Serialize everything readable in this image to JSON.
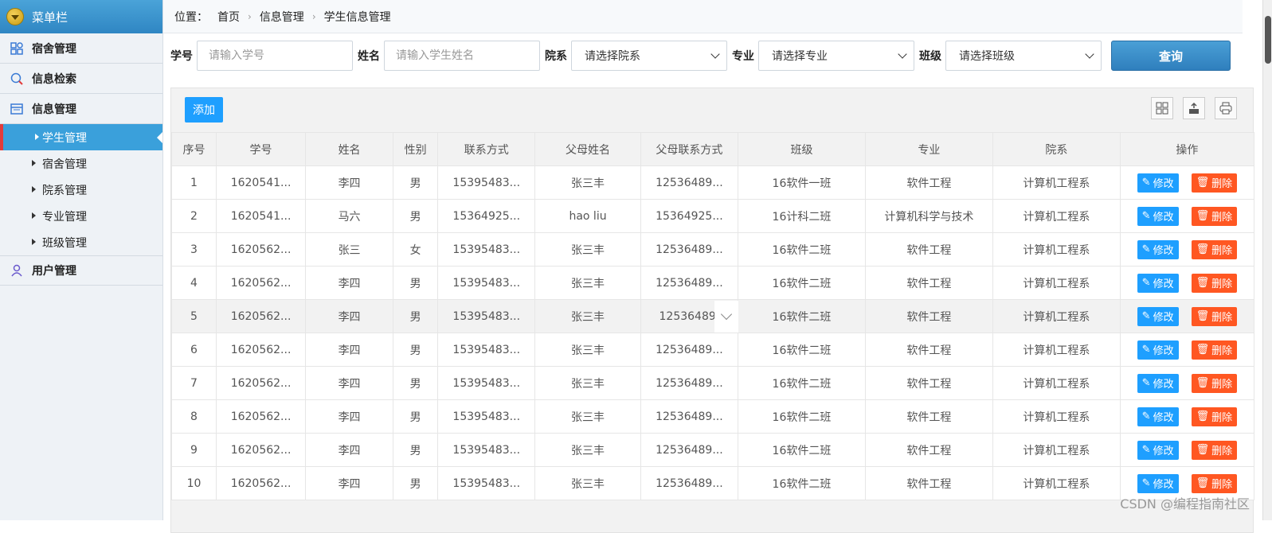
{
  "sidebar": {
    "title": "菜单栏",
    "groups": [
      {
        "label": "宿舍管理"
      },
      {
        "label": "信息检索"
      },
      {
        "label": "信息管理"
      },
      {
        "label": "用户管理"
      }
    ],
    "subitems": [
      "学生管理",
      "宿舍管理",
      "院系管理",
      "专业管理",
      "班级管理"
    ]
  },
  "breadcrumb": {
    "position_label": "位置：",
    "items": [
      "首页",
      "信息管理",
      "学生信息管理"
    ]
  },
  "search": {
    "id_label": "学号",
    "id_placeholder": "请输入学号",
    "name_label": "姓名",
    "name_placeholder": "请输入学生姓名",
    "dept_label": "院系",
    "dept_value": "请选择院系",
    "major_label": "专业",
    "major_value": "请选择专业",
    "class_label": "班级",
    "class_value": "请选择班级",
    "query_label": "查询"
  },
  "toolbar": {
    "add_label": "添加"
  },
  "table": {
    "headers": [
      "序号",
      "学号",
      "姓名",
      "性别",
      "联系方式",
      "父母姓名",
      "父母联系方式",
      "班级",
      "专业",
      "院系",
      "操作"
    ],
    "rows": [
      [
        "1",
        "1620541...",
        "李四",
        "男",
        "15395483...",
        "张三丰",
        "12536489...",
        "16软件一班",
        "软件工程",
        "计算机工程系"
      ],
      [
        "2",
        "1620541...",
        "马六",
        "男",
        "15364925...",
        "hao liu",
        "15364925...",
        "16计科二班",
        "计算机科学与技术",
        "计算机工程系"
      ],
      [
        "3",
        "1620562...",
        "张三",
        "女",
        "15395483...",
        "张三丰",
        "12536489...",
        "16软件二班",
        "软件工程",
        "计算机工程系"
      ],
      [
        "4",
        "1620562...",
        "李四",
        "男",
        "15395483...",
        "张三丰",
        "12536489...",
        "16软件二班",
        "软件工程",
        "计算机工程系"
      ],
      [
        "5",
        "1620562...",
        "李四",
        "男",
        "15395483...",
        "张三丰",
        "12536489.",
        "16软件二班",
        "软件工程",
        "计算机工程系"
      ],
      [
        "6",
        "1620562...",
        "李四",
        "男",
        "15395483...",
        "张三丰",
        "12536489...",
        "16软件二班",
        "软件工程",
        "计算机工程系"
      ],
      [
        "7",
        "1620562...",
        "李四",
        "男",
        "15395483...",
        "张三丰",
        "12536489...",
        "16软件二班",
        "软件工程",
        "计算机工程系"
      ],
      [
        "8",
        "1620562...",
        "李四",
        "男",
        "15395483...",
        "张三丰",
        "12536489...",
        "16软件二班",
        "软件工程",
        "计算机工程系"
      ],
      [
        "9",
        "1620562...",
        "李四",
        "男",
        "15395483...",
        "张三丰",
        "12536489...",
        "16软件二班",
        "软件工程",
        "计算机工程系"
      ],
      [
        "10",
        "1620562...",
        "李四",
        "男",
        "15395483...",
        "张三丰",
        "12536489...",
        "16软件二班",
        "软件工程",
        "计算机工程系"
      ]
    ],
    "edit_label": "修改",
    "delete_label": "删除"
  },
  "watermark": "CSDN @编程指南社区",
  "colors": {
    "accent": "#1e9fff",
    "danger": "#ff5722",
    "sidebar_active": "#3aa0db"
  }
}
